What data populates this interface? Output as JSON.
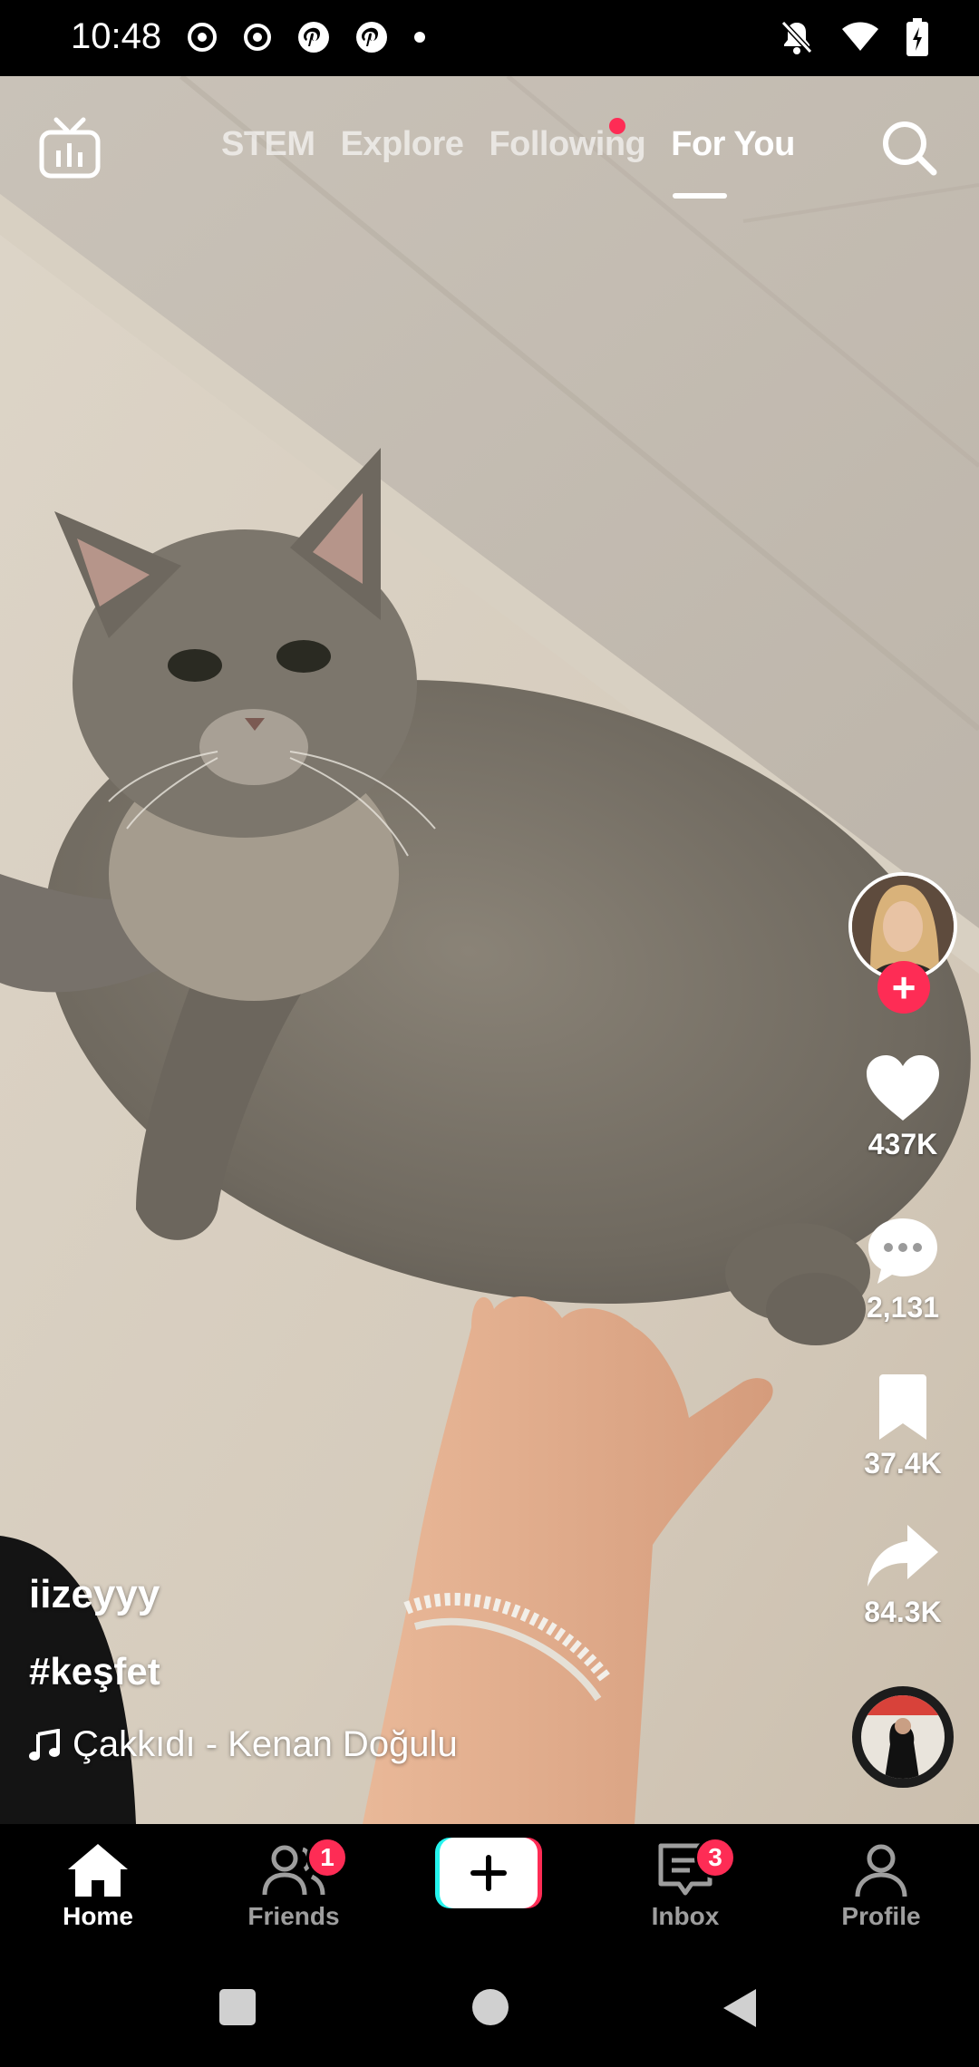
{
  "status_bar": {
    "time": "10:48",
    "left_icons": [
      "threads-icon",
      "circle-record-icon",
      "pinterest-icon",
      "pinterest-icon",
      "dot-icon"
    ],
    "right_icons": [
      "bell-mute-icon",
      "wifi-icon",
      "battery-charging-icon"
    ]
  },
  "top_nav": {
    "tabs": [
      {
        "label": "STEM",
        "active": false
      },
      {
        "label": "Explore",
        "active": false
      },
      {
        "label": "Following",
        "active": false,
        "notification_dot": true
      },
      {
        "label": "For You",
        "active": true
      }
    ]
  },
  "actions": {
    "likes": "437K",
    "comments": "2,131",
    "saves": "37.4K",
    "shares": "84.3K"
  },
  "caption": {
    "username": "iizeyyy",
    "hashtag": "#keşfet",
    "music": "Çakkıdı - Kenan Doğulu"
  },
  "tab_bar": {
    "items": [
      {
        "label": "Home",
        "active": true
      },
      {
        "label": "Friends",
        "badge": "1"
      },
      {
        "label": "Inbox",
        "badge": "3"
      },
      {
        "label": "Profile"
      }
    ]
  },
  "colors": {
    "accent": "#fe2c55",
    "cyan": "#25f4ee"
  }
}
